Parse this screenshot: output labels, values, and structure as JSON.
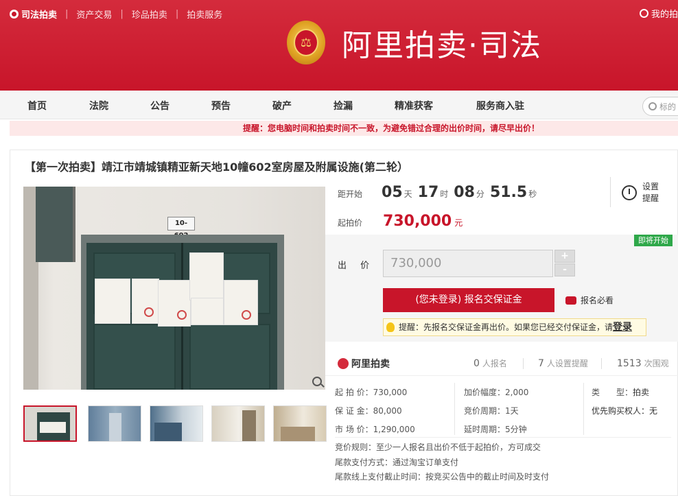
{
  "topnav": {
    "brand": "司法拍卖",
    "items": [
      "资产交易",
      "珍品拍卖",
      "拍卖服务"
    ],
    "my_auction": "我的拍"
  },
  "logo": {
    "text": "阿里拍卖·司法"
  },
  "mainnav": [
    "首页",
    "法院",
    "公告",
    "预告",
    "破产",
    "捡漏",
    "精准获客",
    "服务商入驻"
  ],
  "search": {
    "placeholder": "标的"
  },
  "notice": "提醒：您电脑时间和拍卖时间不一致，为避免错过合理的出价时间，请尽早出价！",
  "item": {
    "title": "【第一次拍卖】靖江市靖城镇精亚新天地10幢602室房屋及附属设施(第二轮）",
    "door_plate": "10-602",
    "countdown_label": "距开始",
    "countdown": {
      "days": "05",
      "days_unit": "天",
      "hours": "17",
      "hours_unit": "时",
      "minutes": "08",
      "minutes_unit": "分",
      "seconds": "51.5",
      "seconds_unit": "秒"
    },
    "start_price_label": "起拍价",
    "start_price": "730,000",
    "start_price_unit": "元",
    "remind_label_1": "设置",
    "remind_label_2": "提醒",
    "status_badge": "即将开始",
    "bid_label": "出 价",
    "bid_value": "730,000",
    "stepper_plus": "+",
    "stepper_minus": "-",
    "signup_button": "(您未登录) 报名交保证金",
    "must_read": "报名必看",
    "tip_text": "提醒：先报名交保证金再出价。如果您已经交付保证金，请",
    "tip_login": "登录"
  },
  "stats": {
    "brand": "阿里拍卖",
    "signups_n": "0",
    "signups_label": "人报名",
    "reminders_n": "7",
    "reminders_label": "人设置提醒",
    "views_n": "1513",
    "views_label": "次围观"
  },
  "info": {
    "start_price_k": "起 拍 价：",
    "start_price_v": "730,000",
    "deposit_k": "保 证 金：",
    "deposit_v": "80,000",
    "market_k": "市 场 价：",
    "market_v": "1,290,000",
    "increment_k": "加价幅度：",
    "increment_v": "2,000",
    "cycle_k": "竞价周期：",
    "cycle_v": "1天",
    "delay_k": "延时周期：",
    "delay_v": "5分钟",
    "type_k": "类　　型：",
    "type_v": "拍卖",
    "priority_k": "优先购买权人",
    "priority_v": "：无",
    "rule_k": "竞价规则：",
    "rule_v": "至少一人报名且出价不低于起拍价，方可成交",
    "pay_method_k": "尾款支付方式：",
    "pay_method_v": "通过淘宝订单支付",
    "pay_deadline_k": "尾款线上支付截止时间：",
    "pay_deadline_v": "按竞买公告中的截止时间及时支付"
  },
  "colors": {
    "brand_red": "#c8152a",
    "badge_green": "#2fa84a"
  }
}
